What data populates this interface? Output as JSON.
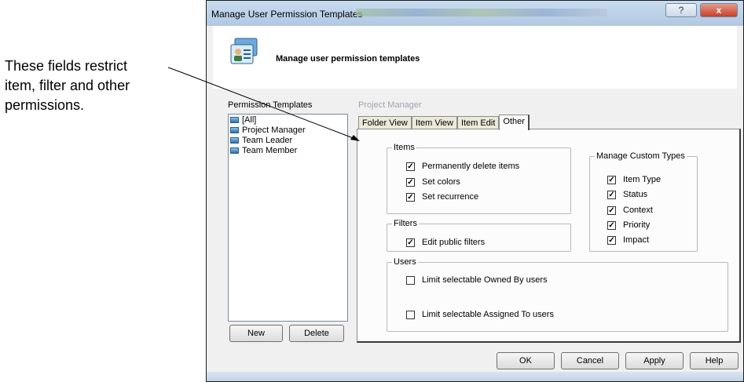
{
  "callout": {
    "lines": [
      "These fields restrict",
      "item, filter and other",
      "permissions."
    ]
  },
  "window": {
    "title": "Manage User Permission Templates",
    "help_button": "?",
    "close_button": "x",
    "header_title": "Manage user permission templates"
  },
  "left_panel": {
    "label": "Permission Templates",
    "items": [
      "[All]",
      "Project Manager",
      "Team Leader",
      "Team Member"
    ],
    "new_button": "New",
    "delete_button": "Delete"
  },
  "right_panel": {
    "selected_template": "Project Manager",
    "tabs": [
      "Folder View",
      "Item View",
      "Item Edit",
      "Other"
    ],
    "active_tab": "Other",
    "groups": {
      "items": {
        "title": "Items",
        "options": [
          {
            "label": "Permanently delete items",
            "checked": true
          },
          {
            "label": "Set colors",
            "checked": true
          },
          {
            "label": "Set recurrence",
            "checked": true
          }
        ]
      },
      "filters": {
        "title": "Filters",
        "options": [
          {
            "label": "Edit public filters",
            "checked": true
          }
        ]
      },
      "custom_types": {
        "title": "Manage Custom Types",
        "options": [
          {
            "label": "Item Type",
            "checked": true
          },
          {
            "label": "Status",
            "checked": true
          },
          {
            "label": "Context",
            "checked": true
          },
          {
            "label": "Priority",
            "checked": true
          },
          {
            "label": "Impact",
            "checked": true
          }
        ]
      },
      "users": {
        "title": "Users",
        "options": [
          {
            "label": "Limit selectable Owned By users",
            "checked": false
          },
          {
            "label": "Limit selectable Assigned To users",
            "checked": false
          }
        ]
      }
    }
  },
  "footer": {
    "ok": "OK",
    "cancel": "Cancel",
    "apply": "Apply",
    "help": "Help"
  }
}
